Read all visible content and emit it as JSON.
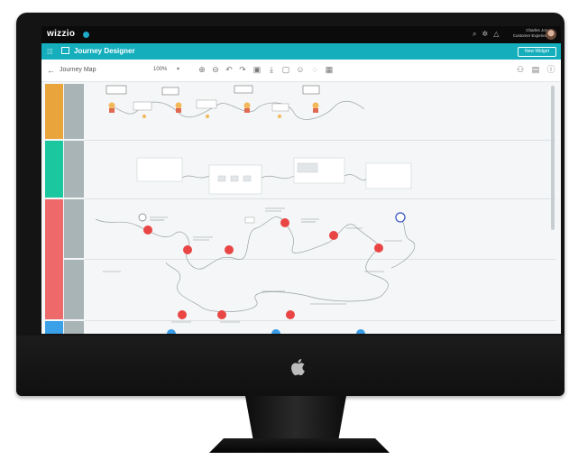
{
  "topbar": {
    "brand": "wizzio",
    "user_line1": "Charles Jones",
    "user_line2": "Customer Experience"
  },
  "designer_bar": {
    "title": "Journey Designer",
    "new_widget_label": "New Widget"
  },
  "toolbar": {
    "back_icon": "arrow-left-icon",
    "map_title": "Journey Map",
    "zoom": "100%",
    "tools": [
      "zoom-in-icon",
      "zoom-out-icon",
      "undo-icon",
      "redo-icon",
      "save-icon",
      "download-icon",
      "frame-icon",
      "user-icon",
      "emoji-icon",
      "image-icon"
    ],
    "right_tools": [
      "people-icon",
      "document-icon",
      "info-icon"
    ]
  },
  "lanes": [
    {
      "color": "#e9a53b"
    },
    {
      "color": "#1bc79f"
    },
    {
      "color": "#ee6a6a"
    },
    {
      "color": "#3aa0e8"
    }
  ],
  "colors": {
    "accent": "#14aebd",
    "touchpoint_red": "#ea4545",
    "touchpoint_blue": "#3a9be6",
    "lane_sub": "#a9b4b7"
  }
}
